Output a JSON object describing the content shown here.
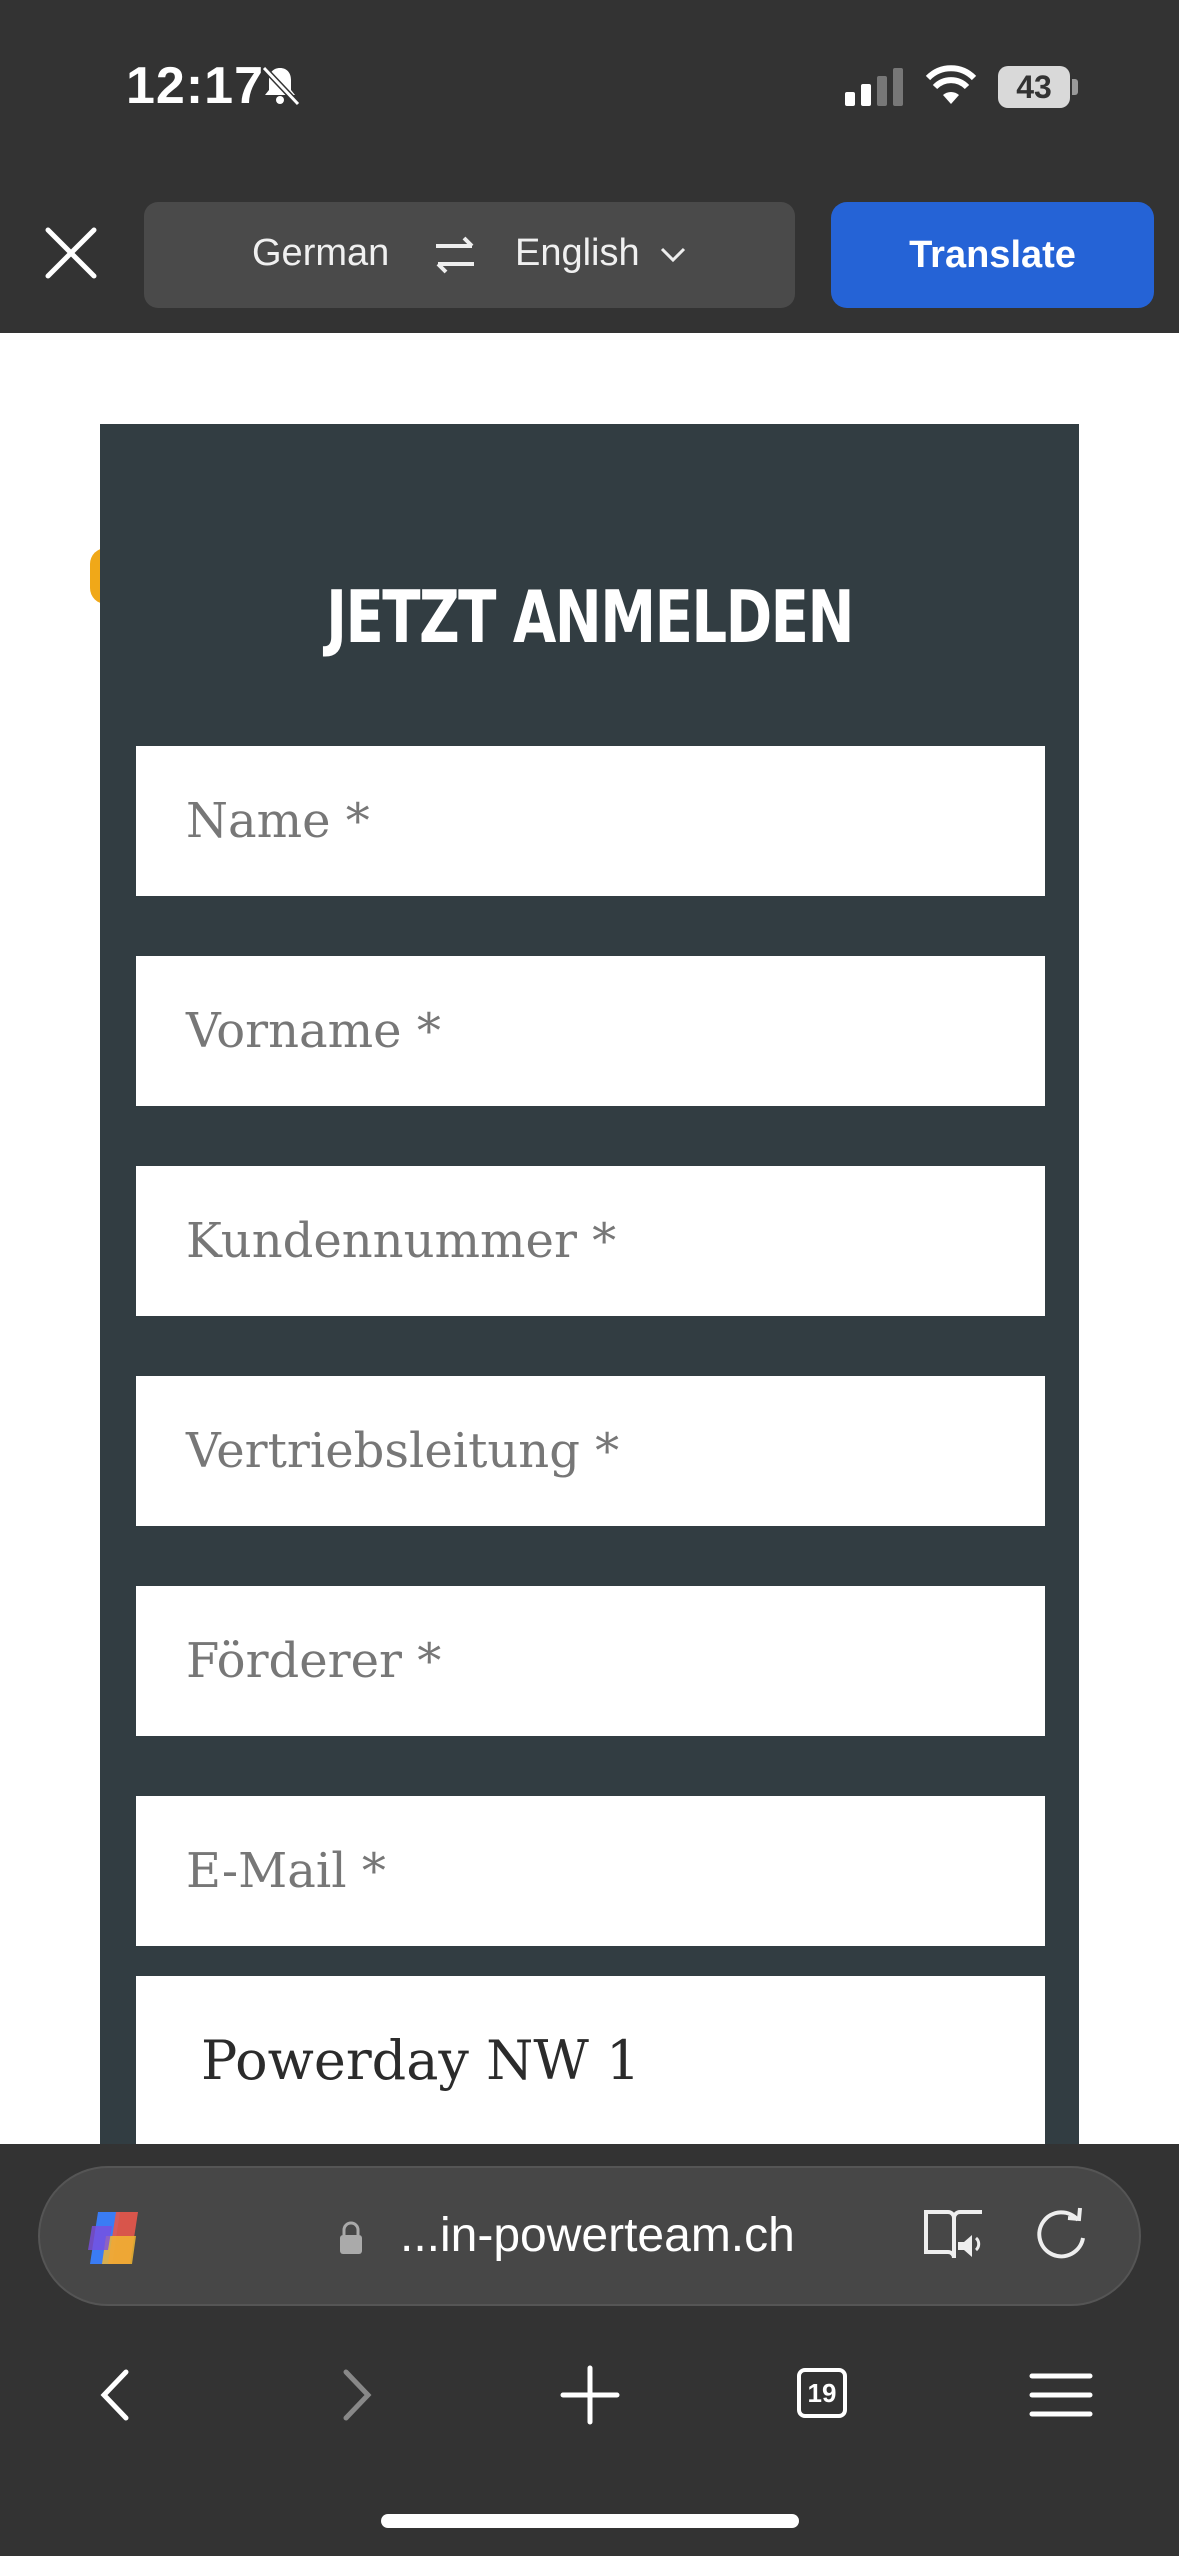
{
  "status": {
    "time": "12:17",
    "battery": "43"
  },
  "translate_bar": {
    "from_lang": "German",
    "to_lang": "English",
    "translate_label": "Translate"
  },
  "form": {
    "title": "JETZT ANMELDEN",
    "fields": [
      {
        "placeholder": "Name *"
      },
      {
        "placeholder": "Vorname *"
      },
      {
        "placeholder": "Kundennummer *"
      },
      {
        "placeholder": "Vertriebsleitung *"
      },
      {
        "placeholder": "Förderer *"
      },
      {
        "placeholder": "E-Mail *"
      }
    ],
    "select_value": "Powerday NW 1"
  },
  "address_bar": {
    "url": "...in-powerteam.ch"
  },
  "toolbar": {
    "tab_count": "19"
  },
  "colors": {
    "translate_button": "#2563d6",
    "form_panel": "#323d42",
    "chrome": "#333333"
  }
}
